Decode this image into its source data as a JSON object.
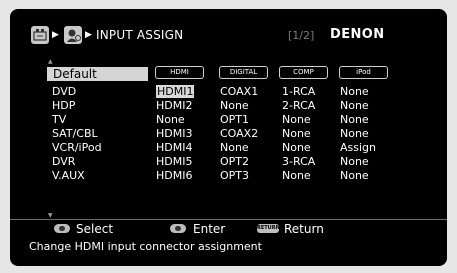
{
  "header": {
    "title": "INPUT ASSIGN",
    "page_indicator": "[1/2]",
    "brand": "DENON"
  },
  "default_item": "Default",
  "columns": [
    "HDMI",
    "DIGITAL",
    "COMP",
    "iPod"
  ],
  "rows": [
    {
      "label": "DVD",
      "values": [
        "HDMI1",
        "COAX1",
        "1-RCA",
        "None"
      ]
    },
    {
      "label": "HDP",
      "values": [
        "HDMI2",
        "None",
        "2-RCA",
        "None"
      ]
    },
    {
      "label": "TV",
      "values": [
        "None",
        "OPT1",
        "None",
        "None"
      ]
    },
    {
      "label": "SAT/CBL",
      "values": [
        "HDMI3",
        "COAX2",
        "None",
        "None"
      ]
    },
    {
      "label": "VCR/iPod",
      "values": [
        "HDMI4",
        "None",
        "None",
        "Assign"
      ]
    },
    {
      "label": "DVR",
      "values": [
        "HDMI5",
        "OPT2",
        "3-RCA",
        "None"
      ]
    },
    {
      "label": "V.AUX",
      "values": [
        "HDMI6",
        "OPT3",
        "None",
        "None"
      ]
    }
  ],
  "footer": {
    "select_label": "Select",
    "enter_label": "Enter",
    "return_key": "RETURN",
    "return_label": "Return",
    "help_text": "Change HDMI input connector assignment"
  }
}
